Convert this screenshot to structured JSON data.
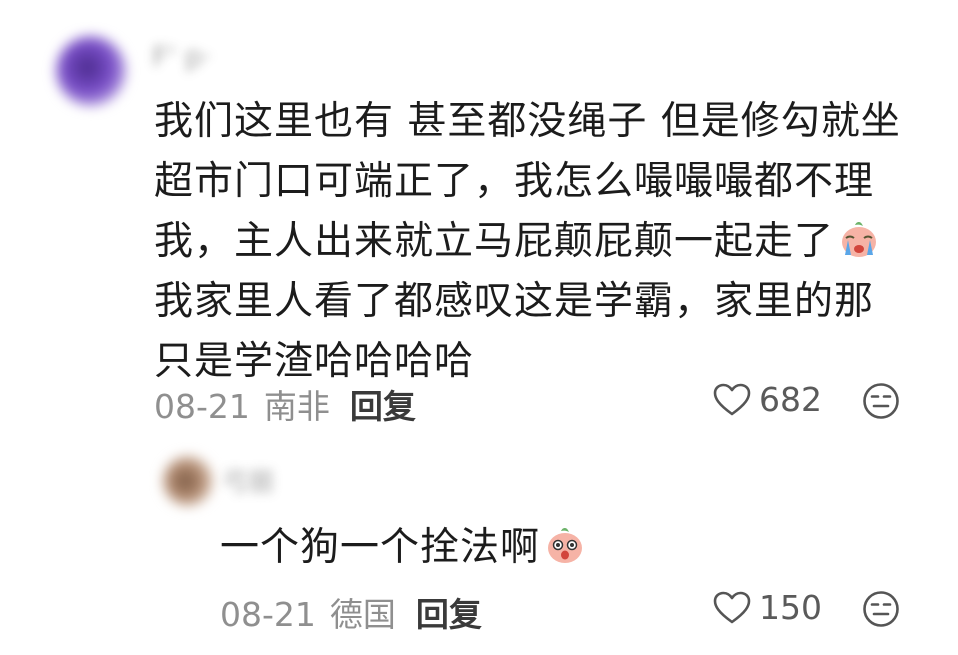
{
  "comments": [
    {
      "author": "F' p·",
      "lines": [
        "我们这里也有 甚至都没绳子 但是修勾就坐",
        "超市门口可端正了，我怎么嘬嘬嘬都不理",
        "我，主人出来就立马屁颠屁颠一起走了",
        "我家里人看了都感叹这是学霸，家里的那",
        "只是学渣哈哈哈哈"
      ],
      "line3_emoji": "crying-emoji",
      "date": "08-21",
      "location": "南非",
      "reply_label": "回复",
      "likes": "682"
    },
    {
      "author": "弓丽",
      "text": "一个狗一个拴法啊",
      "emoji": "shocked-emoji",
      "date": "08-21",
      "location": "德国",
      "reply_label": "回复",
      "likes": "150"
    }
  ],
  "icons": {
    "like": "heart-outline-icon",
    "react": "neutral-face-icon"
  },
  "colors": {
    "text": "#1c1c1c",
    "meta": "#8f8f8f",
    "reply": "#3a3a3a",
    "emoji": "#f4a99b"
  }
}
